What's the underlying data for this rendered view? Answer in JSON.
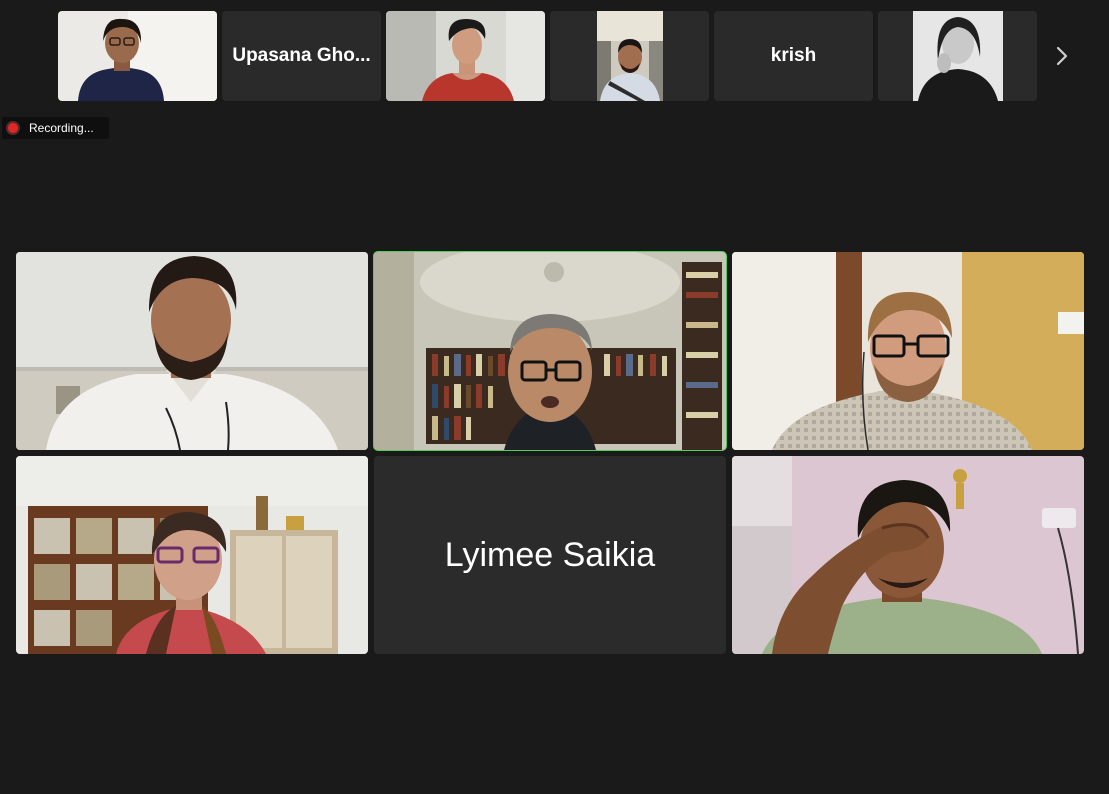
{
  "filmstrip": {
    "participants": [
      {
        "kind": "video"
      },
      {
        "kind": "name",
        "name": "Upasana Gho..."
      },
      {
        "kind": "video"
      },
      {
        "kind": "video"
      },
      {
        "kind": "name",
        "name": "krish"
      },
      {
        "kind": "video"
      }
    ],
    "next_icon": "chevron-right-icon"
  },
  "recording": {
    "label": "Recording...",
    "dot_color": "#e02828"
  },
  "gallery": {
    "active_speaker_color": "#4ed05b",
    "tiles": [
      {
        "kind": "video"
      },
      {
        "kind": "video",
        "active": true
      },
      {
        "kind": "video"
      },
      {
        "kind": "video"
      },
      {
        "kind": "name",
        "name": "Lyimee Saikia"
      },
      {
        "kind": "video"
      }
    ]
  }
}
